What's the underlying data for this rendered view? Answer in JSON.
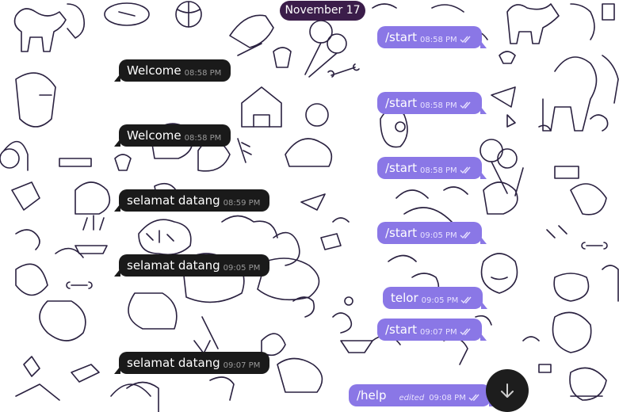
{
  "date_chip": "November 17",
  "messages": [
    {
      "text": "Welcome",
      "time": "08:58 PM",
      "dir": "in"
    },
    {
      "text": "Welcome",
      "time": "08:58 PM",
      "dir": "in"
    },
    {
      "text": "selamat datang",
      "time": "08:59 PM",
      "dir": "in"
    },
    {
      "text": "selamat datang",
      "time": "09:05 PM",
      "dir": "in"
    },
    {
      "text": "selamat datang",
      "time": "09:07 PM",
      "dir": "in"
    },
    {
      "text": "/start",
      "time": "08:58 PM",
      "dir": "out"
    },
    {
      "text": "/start",
      "time": "08:58 PM",
      "dir": "out"
    },
    {
      "text": "/start",
      "time": "08:58 PM",
      "dir": "out"
    },
    {
      "text": "/start",
      "time": "09:05 PM",
      "dir": "out"
    },
    {
      "text": "telor",
      "time": "09:05 PM",
      "dir": "out"
    },
    {
      "text": "/start",
      "time": "09:07 PM",
      "dir": "out"
    },
    {
      "text": "/help",
      "time": "09:08 PM",
      "dir": "out",
      "edited": "edited"
    }
  ],
  "colors": {
    "incoming_bubble": "#1a1a1a",
    "outgoing_bubble": "#8a77e6",
    "date_chip": "#3b1d4a",
    "wallpaper_line": "#2a2140"
  },
  "icons": {
    "read_receipt": "double-check-icon",
    "scroll_down": "arrow-down-icon"
  }
}
